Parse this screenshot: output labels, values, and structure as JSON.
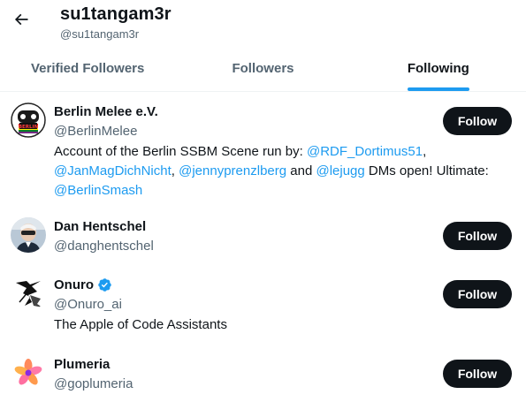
{
  "header": {
    "title": "su1tangam3r",
    "subtitle": "@su1tangam3r"
  },
  "tabs": [
    {
      "label": "Verified Followers"
    },
    {
      "label": "Followers"
    },
    {
      "label": "Following"
    }
  ],
  "users": [
    {
      "name": "Berlin Melee e.V.",
      "handle": "@BerlinMelee",
      "follow_label": "Follow",
      "bio": {
        "t1": "Account of the Berlin SSBM Scene run by: ",
        "m1": "@RDF_Dortimus51",
        "t2": ", ",
        "m2": "@JanMagDichNicht",
        "t3": ", ",
        "m3": "@jennyprenzlberg",
        "t4": " and ",
        "m4": "@lejugg",
        "t5": " DMs open! Ultimate: ",
        "m5": "@BerlinSmash"
      }
    },
    {
      "name": "Dan Hentschel",
      "handle": "@danghentschel",
      "follow_label": "Follow"
    },
    {
      "name": "Onuro",
      "handle": "@Onuro_ai",
      "follow_label": "Follow",
      "bio": "The Apple of Code Assistants"
    },
    {
      "name": "Plumeria",
      "handle": "@goplumeria",
      "follow_label": "Follow"
    }
  ],
  "colors": {
    "accent": "#1d9bf0",
    "text": "#0f1419",
    "muted": "#536471",
    "button": "#0f1419"
  },
  "icons": {
    "back": "back-arrow-icon",
    "verified": "verified-badge-icon"
  }
}
